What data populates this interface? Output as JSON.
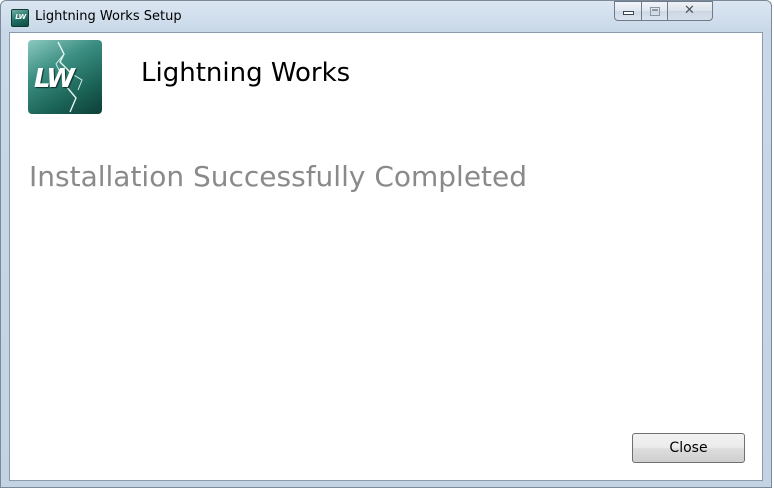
{
  "window": {
    "title": "Lightning Works Setup",
    "app_icon_label": "LW"
  },
  "content": {
    "logo_label": "LW",
    "product_title": "Lightning Works",
    "status": "Installation Successfully Completed"
  },
  "buttons": {
    "close_label": "Close"
  },
  "icons": {
    "app": "lightning-works-logo-icon",
    "minimize": "minimize-icon",
    "maximize": "maximize-icon",
    "close": "close-icon"
  },
  "colors": {
    "logo_dark": "#0e3f36",
    "logo_light": "#8cc9c0",
    "status_text": "#8a8a8a"
  }
}
